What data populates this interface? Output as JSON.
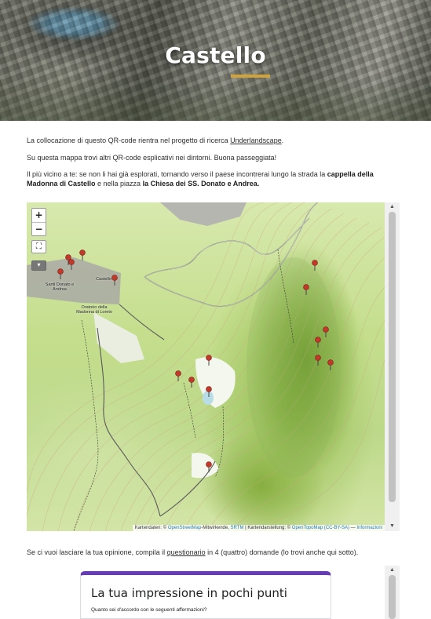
{
  "hero": {
    "title": "Castello"
  },
  "intro": {
    "p1_pre": "La collocazione di questo QR-code rientra nel progetto di ricerca ",
    "p1_link": "Underlandscape",
    "p1_post": ".",
    "p2": "Su questa mappa trovi altri QR-code esplicativi nei dintorni. Buona passeggiata!",
    "p3_pre": "Il più vicino a te: se non li hai già esplorati, tornando verso il paese incontrerai lungo la strada la ",
    "p3_bold1": "cappella della Madonna di Castello",
    "p3_mid": " e nella piazza ",
    "p3_bold2": "la Chiesa dei SS. Donato e Andrea."
  },
  "map": {
    "zoom_in": "+",
    "zoom_out": "−",
    "fullscreen_icon": "fullscreen-icon",
    "layers_icon": "layers-icon",
    "labels": {
      "church": "Santi Donato e Andrea",
      "castello": "Castello",
      "oratorio": "Oratorio della Madonna di Loreto"
    },
    "attribution": {
      "prefix": "Kartendaten: © ",
      "osm": "OpenStreetMap",
      "mid1": "-Mitwirkende, ",
      "srtm": "SRTM",
      "mid2": " | Kartendarstellung: © ",
      "otm": "OpenTopoMap",
      "license": "(CC-BY-SA)",
      "sep": " — ",
      "info": "Informazioni"
    },
    "marker_color": "#c0392b",
    "accent_color": "#d1a43b"
  },
  "opinion": {
    "pre": "Se ci vuoi lasciare la tua opinione, compila il ",
    "link": "questionario",
    "post": " in 4 (quattro) domande (lo trovi anche qui sotto)."
  },
  "form": {
    "title": "La tua impressione in pochi punti",
    "subtitle": "Quanto sei d'accordo con le seguenti affermazioni?",
    "accent_color": "#673ab7"
  },
  "scrollbar": {
    "up": "▲",
    "down": "▼"
  }
}
